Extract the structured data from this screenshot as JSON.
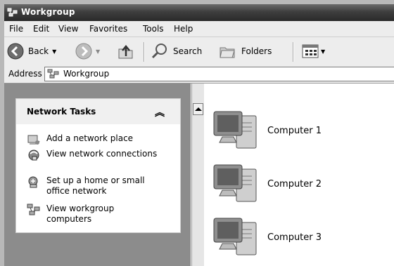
{
  "window": {
    "title": "Workgroup"
  },
  "menu": [
    "File",
    "Edit",
    "View",
    "Favorites",
    "Tools",
    "Help"
  ],
  "toolbar": {
    "back": "Back",
    "search": "Search",
    "folders": "Folders"
  },
  "address": {
    "label": "Address",
    "value": "Workgroup"
  },
  "task_pane": {
    "title": "Network Tasks",
    "items": [
      {
        "label": "Add a network place",
        "icon": "add-network-place-icon"
      },
      {
        "label": "View network connections",
        "icon": "network-connections-icon"
      },
      {
        "label": "Set up a home or small office network",
        "icon": "home-network-icon"
      },
      {
        "label": "View workgroup computers",
        "icon": "workgroup-computers-icon"
      }
    ]
  },
  "computers": [
    "Computer 1",
    "Computer 2",
    "Computer 3"
  ]
}
